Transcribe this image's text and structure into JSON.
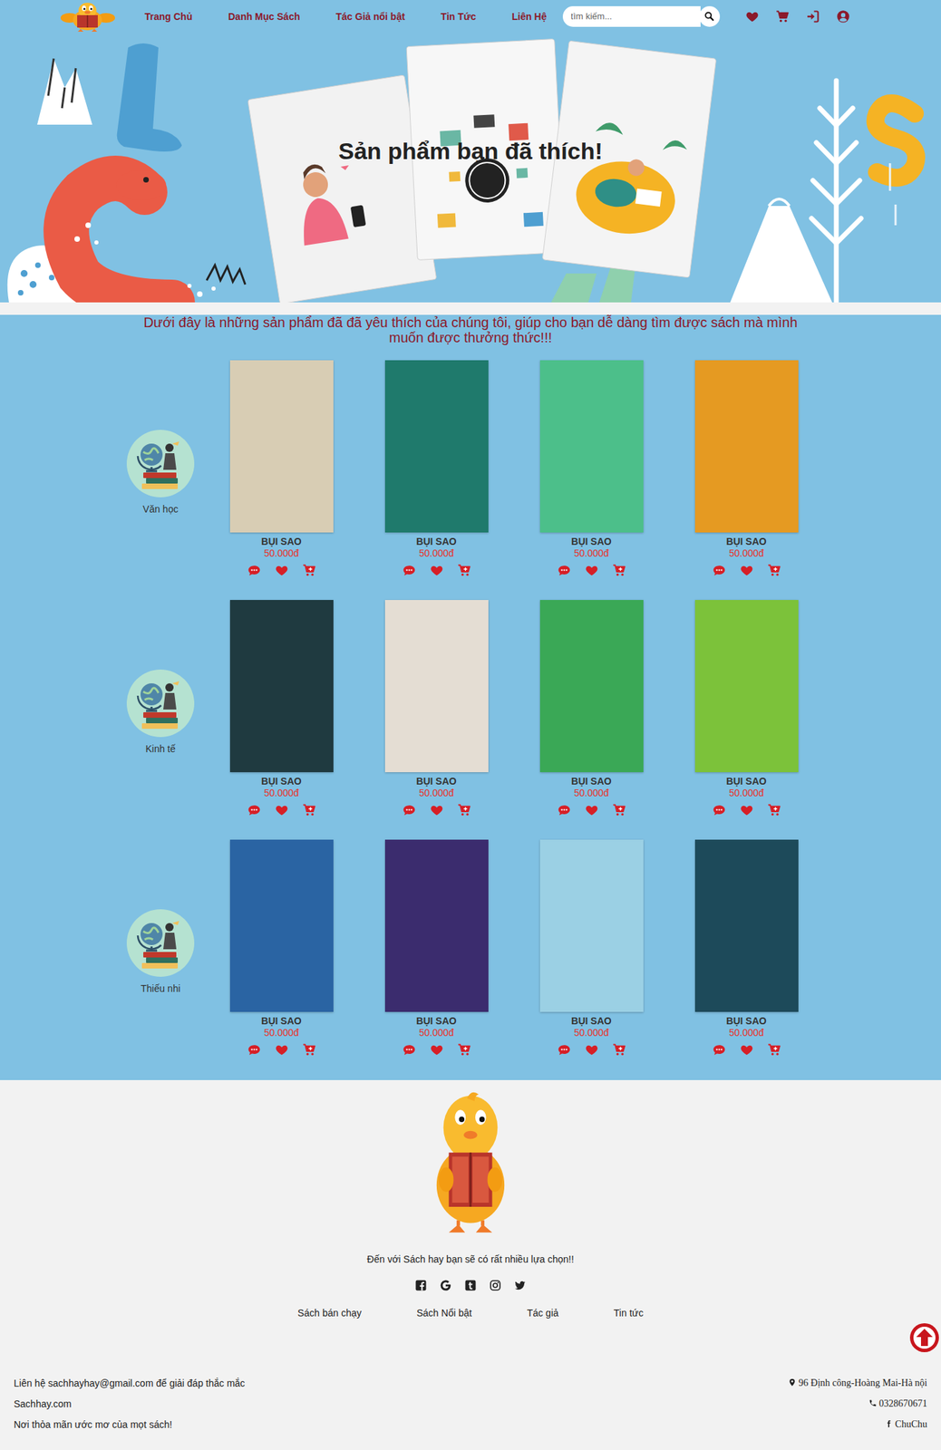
{
  "nav": {
    "links": [
      {
        "label": "Trang Chủ",
        "selected": false
      },
      {
        "label": "Danh Mục Sách",
        "selected": false
      },
      {
        "label": "Tác Giả nổi bật",
        "selected": false
      },
      {
        "label": "Tin Tức",
        "selected": false
      },
      {
        "label": "Liên Hệ",
        "selected": false
      }
    ]
  },
  "search": {
    "placeholder": "tìm kiếm..."
  },
  "hero": {
    "title": "Sản phẩm bạn đã thích!"
  },
  "intro": "Dưới đây là những sản phẩm đã đã yêu thích của chúng tôi, giúp cho bạn dễ dàng tìm được sách mà mình muốn được thưởng thức!!!",
  "categories": [
    {
      "name": "Văn học",
      "books": [
        {
          "title": "BỤI SAO",
          "price": "50.000đ",
          "color": "#d8cdb4"
        },
        {
          "title": "BỤI SAO",
          "price": "50.000đ",
          "color": "#1f7a6c"
        },
        {
          "title": "BỤI SAO",
          "price": "50.000đ",
          "color": "#4cbf8a"
        },
        {
          "title": "BỤI SAO",
          "price": "50.000đ",
          "color": "#e59a22"
        }
      ]
    },
    {
      "name": "Kinh tế",
      "books": [
        {
          "title": "BỤI SAO",
          "price": "50.000đ",
          "color": "#1f3a40"
        },
        {
          "title": "BỤI SAO",
          "price": "50.000đ",
          "color": "#e4ddd3"
        },
        {
          "title": "BỤI SAO",
          "price": "50.000đ",
          "color": "#3aa856"
        },
        {
          "title": "BỤI SAO",
          "price": "50.000đ",
          "color": "#7cc23a"
        }
      ]
    },
    {
      "name": "Thiếu nhi",
      "books": [
        {
          "title": "BỤI SAO",
          "price": "50.000đ",
          "color": "#2a64a3"
        },
        {
          "title": "BỤI SAO",
          "price": "50.000đ",
          "color": "#3b2c6e"
        },
        {
          "title": "BỤI SAO",
          "price": "50.000đ",
          "color": "#9bd0e4"
        },
        {
          "title": "BỤI SAO",
          "price": "50.000đ",
          "color": "#1d4a5a"
        }
      ]
    }
  ],
  "footer": {
    "slogan": "Đến với Sách hay bạn sẽ có rất nhiều lựa chọn!!",
    "links": [
      "Sách bán chạy",
      "Sách Nổi bật",
      "Tác giả",
      "Tin tức"
    ],
    "info": [
      "Liên hệ sachhayhay@gmail.com để giải đáp thắc mắc",
      "Sachhay.com",
      "Nơi thỏa mãn ước mơ của mọt sách!"
    ],
    "contact": [
      {
        "kind": "address",
        "text": "96 Định công-Hoàng Mai-Hà nội"
      },
      {
        "kind": "phone",
        "text": "0328670671"
      },
      {
        "kind": "facebook",
        "text": "ChuChu"
      }
    ]
  }
}
